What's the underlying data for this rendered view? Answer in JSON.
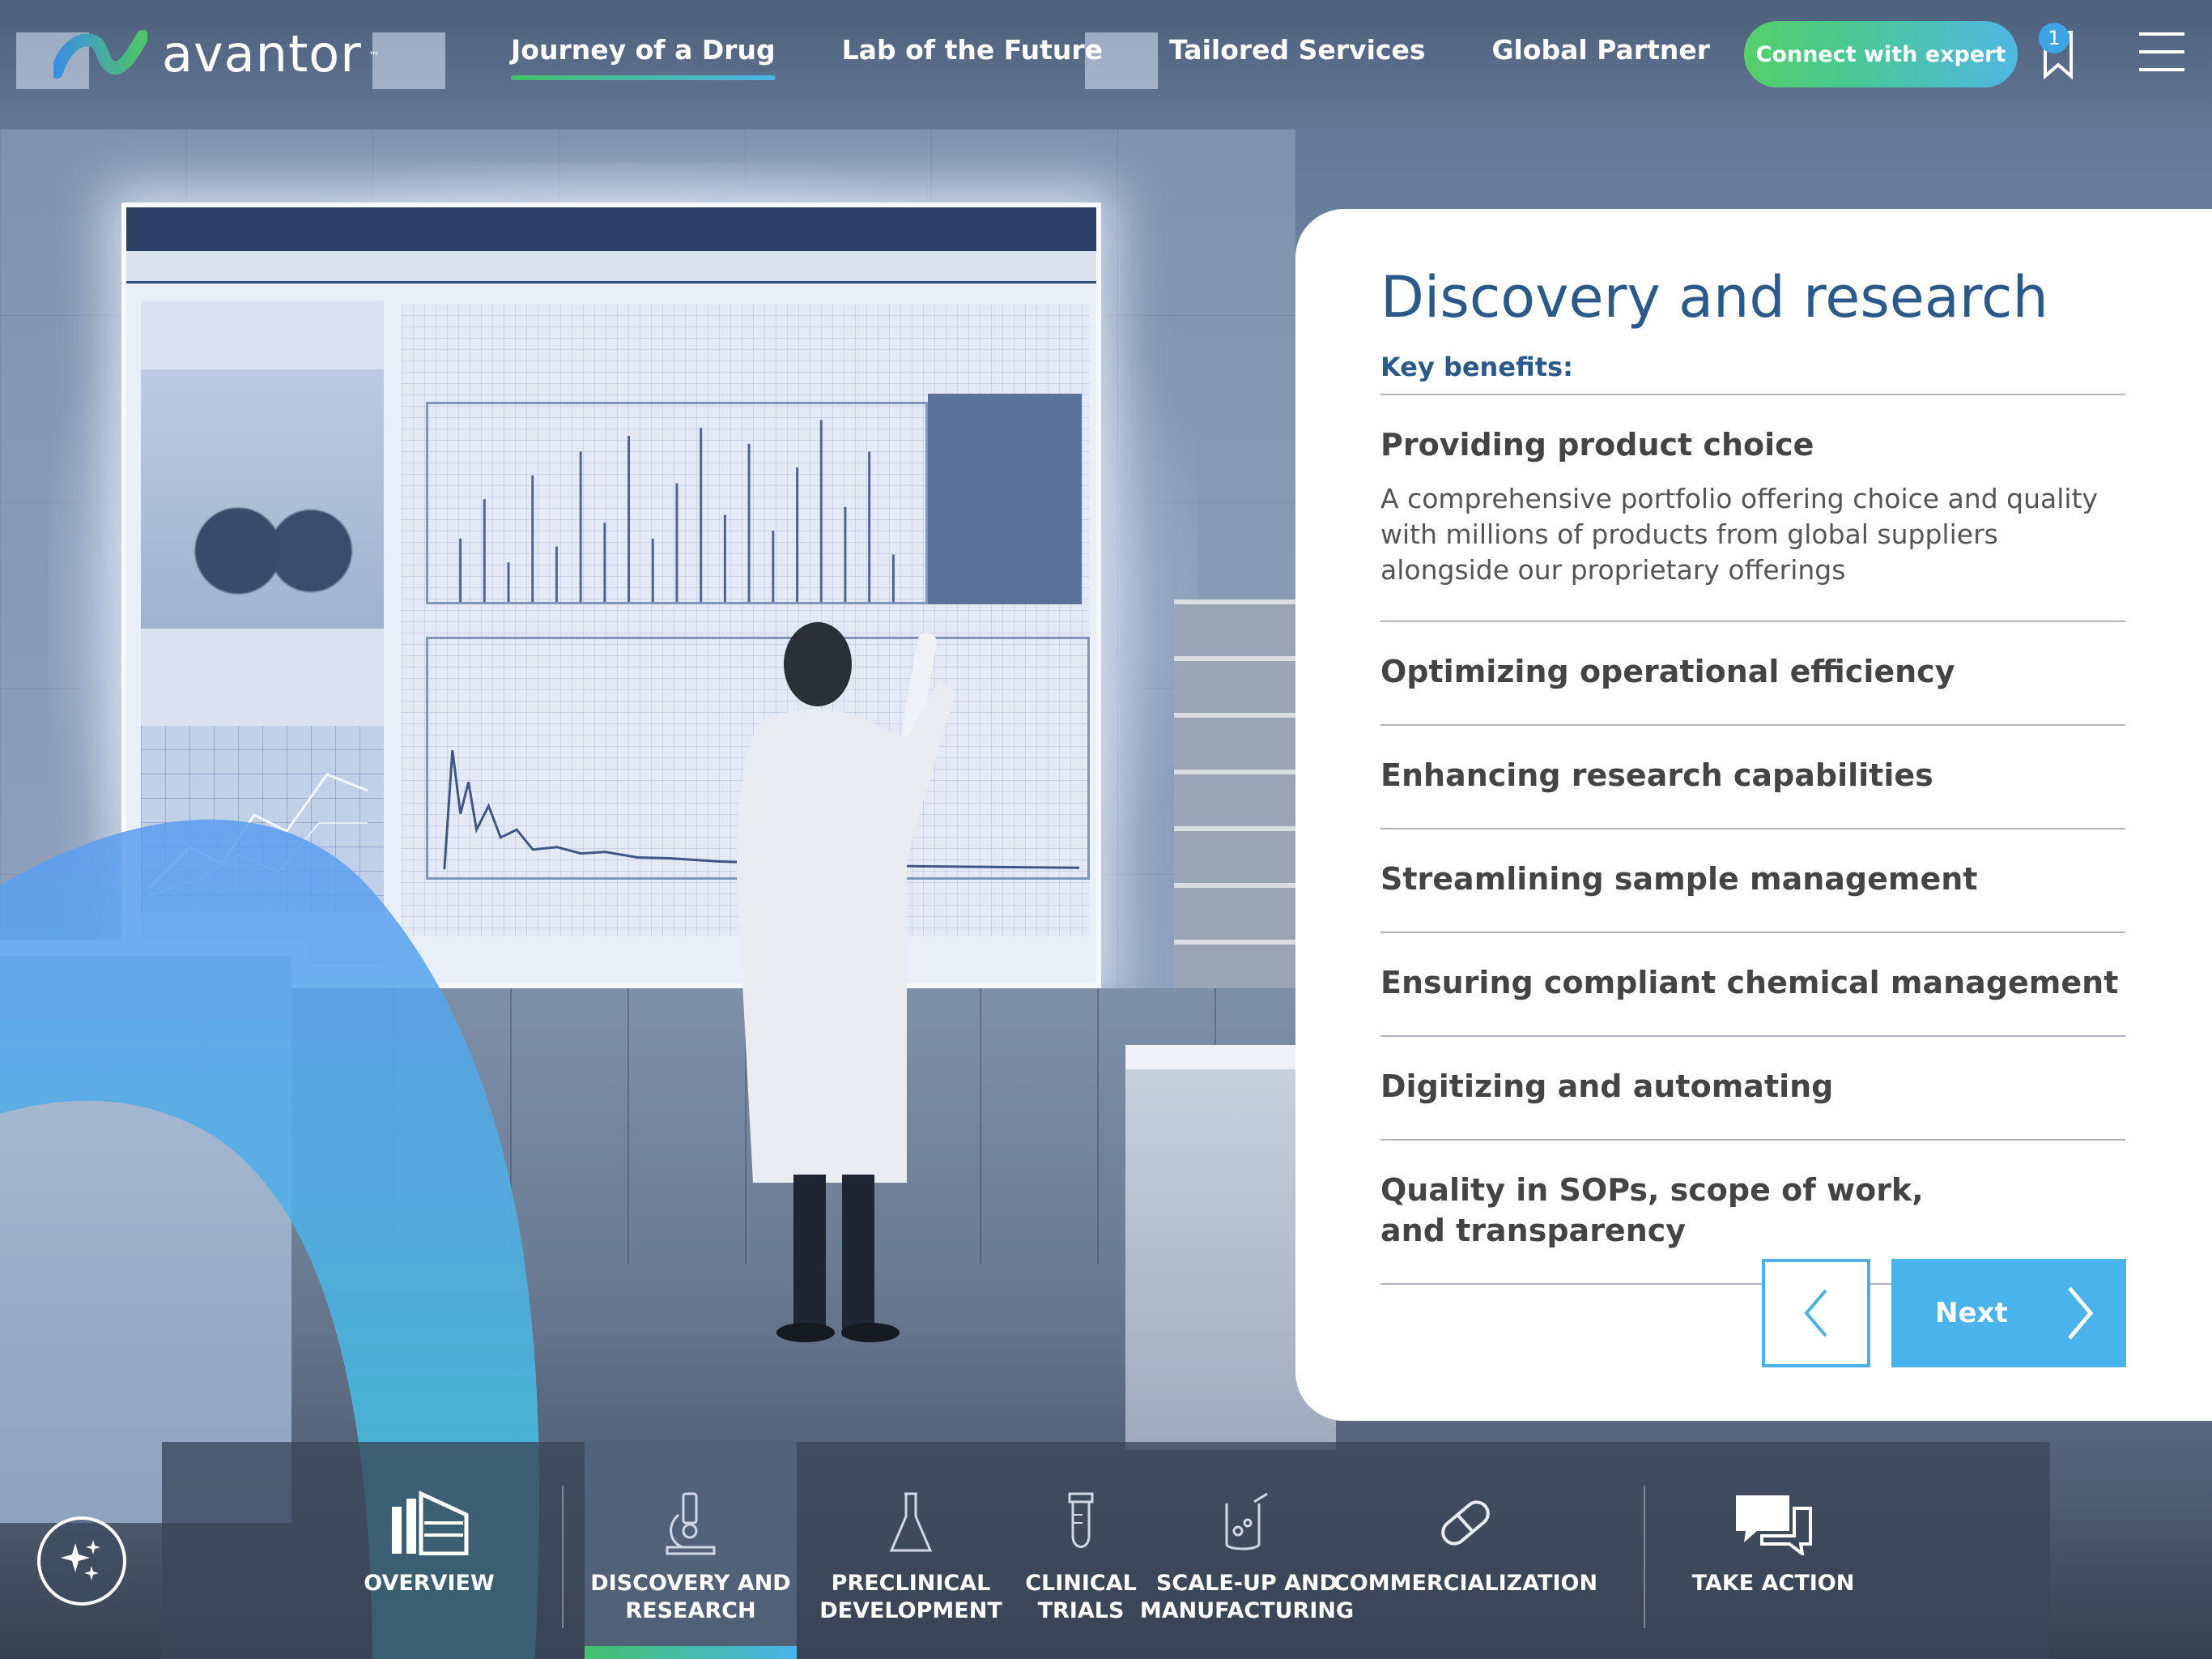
{
  "brand": {
    "name": "avantor",
    "tm": "™"
  },
  "nav": {
    "items": [
      {
        "label": "Journey of a Drug",
        "active": true
      },
      {
        "label": "Lab of the Future",
        "active": false
      },
      {
        "label": "Tailored Services",
        "active": false
      },
      {
        "label": "Global Partner",
        "active": false
      }
    ]
  },
  "header": {
    "connect_label": "Connect with expert",
    "bookmark_count": "1",
    "icons": [
      "bookmark-icon",
      "menu-icon"
    ]
  },
  "card": {
    "title": "Discovery and research",
    "subtitle": "Key benefits:",
    "benefits": [
      {
        "title": "Providing product choice",
        "description": "A comprehensive portfolio offering choice and quality with millions of products from global suppliers alongside our proprietary offerings",
        "expanded": true
      },
      {
        "title": "Optimizing operational efficiency",
        "expanded": false
      },
      {
        "title": "Enhancing research capabilities",
        "expanded": false
      },
      {
        "title": "Streamlining sample management",
        "expanded": false
      },
      {
        "title": "Ensuring compliant chemical management",
        "expanded": false
      },
      {
        "title": "Digitizing and automating",
        "expanded": false
      },
      {
        "title": "Quality in SOPs, scope of work, and transparency",
        "expanded": false
      }
    ],
    "next_label": "Next"
  },
  "tabs": [
    {
      "label": "OVERVIEW",
      "icon": "building-icon",
      "active": false
    },
    {
      "label": "DISCOVERY AND\nRESEARCH",
      "icon": "microscope-icon",
      "active": true
    },
    {
      "label": "PRECLINICAL\nDEVELOPMENT",
      "icon": "flask-icon",
      "active": false
    },
    {
      "label": "CLINICAL\nTRIALS",
      "icon": "test-tube-icon",
      "active": false
    },
    {
      "label": "SCALE-UP AND\nMANUFACTURING",
      "icon": "beaker-icon",
      "active": false
    },
    {
      "label": "COMMERCIALIZATION",
      "icon": "pill-icon",
      "active": false
    },
    {
      "label": "TAKE ACTION",
      "icon": "chat-icon",
      "active": false
    }
  ],
  "colors": {
    "accent_green": "#45c16a",
    "accent_blue": "#4ab3ec",
    "title_blue": "#2b5a8a"
  }
}
